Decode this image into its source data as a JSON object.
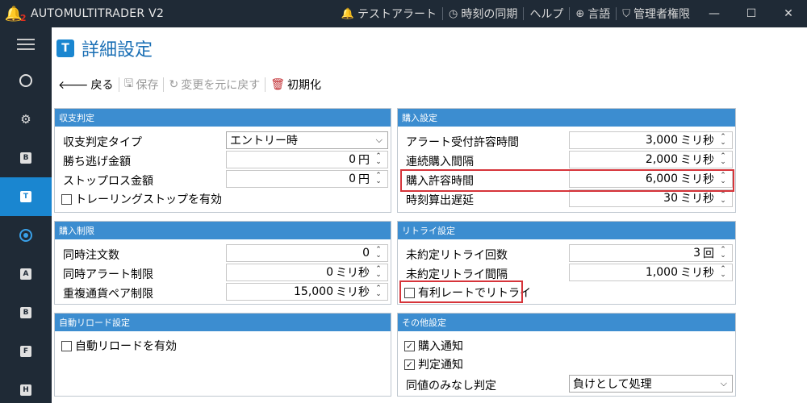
{
  "app": {
    "title": "AUTOMULTITRADER V2",
    "logo_mark": "2",
    "menu": [
      {
        "icon": "bell-icon",
        "glyph": "🔔",
        "label": "テストアラート"
      },
      {
        "icon": "clock-icon",
        "glyph": "◷",
        "label": "時刻の同期"
      },
      {
        "icon": "",
        "glyph": "",
        "label": "ヘルプ"
      },
      {
        "icon": "globe-icon",
        "glyph": "⊕",
        "label": "言語"
      },
      {
        "icon": "shield-icon",
        "glyph": "⛉",
        "label": "管理者権限"
      }
    ],
    "window_controls": {
      "minimize": "—",
      "maximize": "☐",
      "close": "✕"
    }
  },
  "sidebar": {
    "items": [
      {
        "name": "dashboard",
        "badge": ""
      },
      {
        "name": "settings",
        "badge": ""
      },
      {
        "name": "b",
        "badge": "B"
      },
      {
        "name": "t",
        "badge": "T",
        "active": true
      },
      {
        "name": "o",
        "badge": ""
      },
      {
        "name": "a",
        "badge": "A"
      },
      {
        "name": "b2",
        "badge": "B"
      },
      {
        "name": "f",
        "badge": "F"
      },
      {
        "name": "h",
        "badge": "H"
      }
    ]
  },
  "page": {
    "badge": "T",
    "title": "詳細設定"
  },
  "toolbar": {
    "back": "戻る",
    "save": "保存",
    "revert": "変更を元に戻す",
    "reset": "初期化"
  },
  "panels": {
    "settle": {
      "title": "収支判定",
      "type_label": "収支判定タイプ",
      "type_value": "エントリー時",
      "win_label": "勝ち逃げ金額",
      "win_value": "0",
      "win_unit": "円",
      "stop_label": "ストップロス金額",
      "stop_value": "0",
      "stop_unit": "円",
      "trailing_label": "トレーリングストップを有効",
      "trailing_checked": false
    },
    "buy": {
      "title": "購入設定",
      "alert_accept_label": "アラート受付許容時間",
      "alert_accept_value": "3,000",
      "consecutive_label": "連続購入間隔",
      "consecutive_value": "2,000",
      "buy_accept_label": "購入許容時間",
      "buy_accept_value": "6,000",
      "delay_label": "時刻算出遅延",
      "delay_value": "30",
      "unit_ms": "ミリ秒"
    },
    "limit": {
      "title": "購入制限",
      "orders_label": "同時注文数",
      "orders_value": "0",
      "alerts_label": "同時アラート制限",
      "alerts_value": "0",
      "alerts_unit": "ミリ秒",
      "pair_label": "重複通貨ペア制限",
      "pair_value": "15,000",
      "pair_unit": "ミリ秒"
    },
    "retry": {
      "title": "リトライ設定",
      "count_label": "未約定リトライ回数",
      "count_value": "3",
      "count_unit": "回",
      "interval_label": "未約定リトライ間隔",
      "interval_value": "1,000",
      "interval_unit": "ミリ秒",
      "favorable_label": "有利レートでリトライ",
      "favorable_checked": false
    },
    "reload": {
      "title": "自動リロード設定",
      "enable_label": "自動リロードを有効",
      "enable_checked": false
    },
    "other": {
      "title": "その他設定",
      "buy_notify_label": "購入通知",
      "buy_notify_checked": true,
      "judge_notify_label": "判定通知",
      "judge_notify_checked": true,
      "tie_label": "同値のみなし判定",
      "tie_value": "負けとして処理"
    }
  },
  "colors": {
    "accent": "#1a86d0",
    "titlebar": "#1f2a36",
    "panel_header": "#3c8dd0",
    "highlight": "#d6343a"
  }
}
